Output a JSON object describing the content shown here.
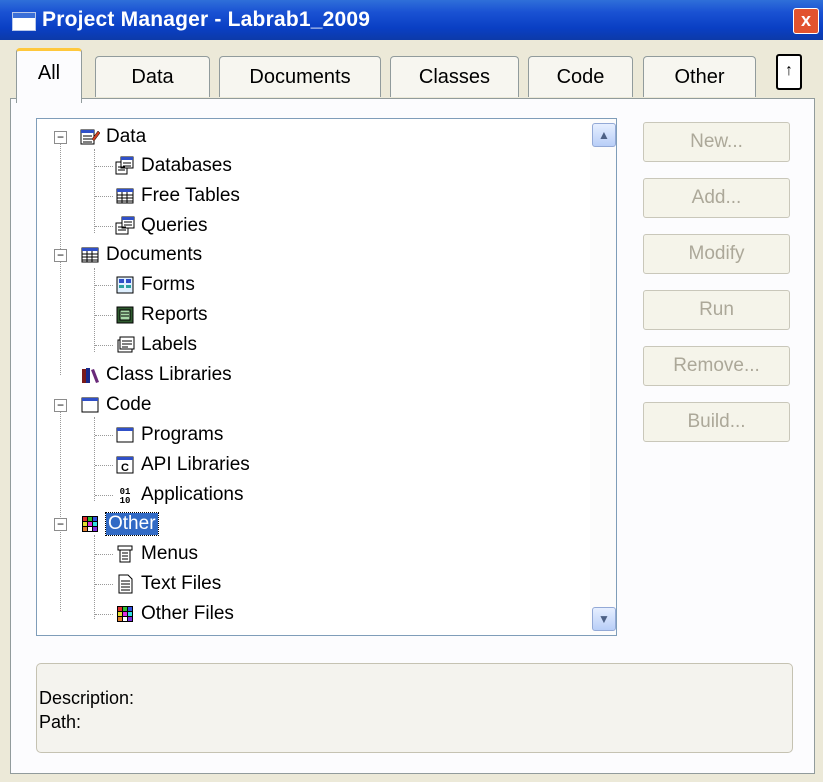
{
  "window": {
    "title": "Project Manager - Labrab1_2009",
    "close_label": "x"
  },
  "tabs": [
    {
      "label": "All",
      "active": true
    },
    {
      "label": "Data"
    },
    {
      "label": "Documents"
    },
    {
      "label": "Classes"
    },
    {
      "label": "Code"
    },
    {
      "label": "Other"
    }
  ],
  "tab_arrow_label": "↑",
  "tree": {
    "items": [
      {
        "label": "Data",
        "icon": "data-icon",
        "expander": "minus"
      },
      {
        "label": "Databases",
        "icon": "database-icon"
      },
      {
        "label": "Free Tables",
        "icon": "table-icon"
      },
      {
        "label": "Queries",
        "icon": "query-icon"
      },
      {
        "label": "Documents",
        "icon": "documents-icon",
        "expander": "minus"
      },
      {
        "label": "Forms",
        "icon": "form-icon"
      },
      {
        "label": "Reports",
        "icon": "report-icon"
      },
      {
        "label": "Labels",
        "icon": "label-icon"
      },
      {
        "label": "Class Libraries",
        "icon": "class-libraries-icon"
      },
      {
        "label": "Code",
        "icon": "code-icon",
        "expander": "minus"
      },
      {
        "label": "Programs",
        "icon": "program-icon"
      },
      {
        "label": "API Libraries",
        "icon": "api-library-icon"
      },
      {
        "label": "Applications",
        "icon": "application-icon"
      },
      {
        "label": "Other",
        "icon": "other-icon",
        "expander": "minus",
        "selected": true
      },
      {
        "label": "Menus",
        "icon": "menu-icon"
      },
      {
        "label": "Text Files",
        "icon": "text-file-icon"
      },
      {
        "label": "Other Files",
        "icon": "other-files-icon"
      }
    ],
    "scroll_up": "▲",
    "scroll_down": "▼"
  },
  "buttons": {
    "new": "New...",
    "add": "Add...",
    "modify": "Modify",
    "run": "Run",
    "remove": "Remove...",
    "build": "Build..."
  },
  "description": {
    "description_label": "Description:",
    "path_label": "Path:"
  },
  "colors": {
    "titlebar": "#0a3fc4",
    "selection": "#316ac5",
    "tab_highlight": "#ffc83c",
    "disabled_text": "#aca899"
  }
}
